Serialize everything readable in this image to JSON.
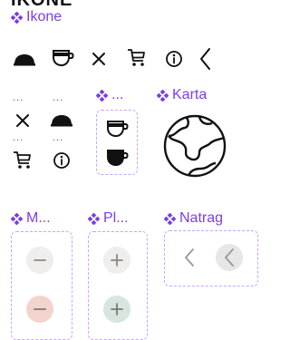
{
  "page": {
    "header": "IKONE"
  },
  "colors": {
    "accent": "#7b3fe4",
    "dashed_border": "#c9a2ff",
    "neutral_circle": "#f0eeec",
    "minus_active_circle": "#f2d4cc",
    "plus_active_circle": "#d6e6de",
    "back_active_circle": "#e6e6e6"
  },
  "components": {
    "ikone": {
      "title": "Ikone",
      "icons": [
        "bell-dome-icon",
        "coffee-cup-icon",
        "close-icon",
        "cart-icon",
        "info-icon",
        "chevron-left-icon"
      ]
    },
    "variants_left": {
      "dots": "...",
      "icons": [
        "close-icon",
        "bell-dome-icon",
        "cart-icon",
        "info-icon"
      ]
    },
    "coffee_cup": {
      "title": "...",
      "icons": [
        "coffee-cup-outline-icon",
        "coffee-cup-filled-icon"
      ]
    },
    "karta": {
      "title": "Karta",
      "icon": "globe-icon"
    },
    "minus": {
      "title": "M...",
      "buttons": [
        "minus-default",
        "minus-active"
      ]
    },
    "plus": {
      "title": "Pl...",
      "buttons": [
        "plus-default",
        "plus-active"
      ]
    },
    "natrag": {
      "title": "Natrag",
      "buttons": [
        "back-default",
        "back-active"
      ]
    }
  }
}
